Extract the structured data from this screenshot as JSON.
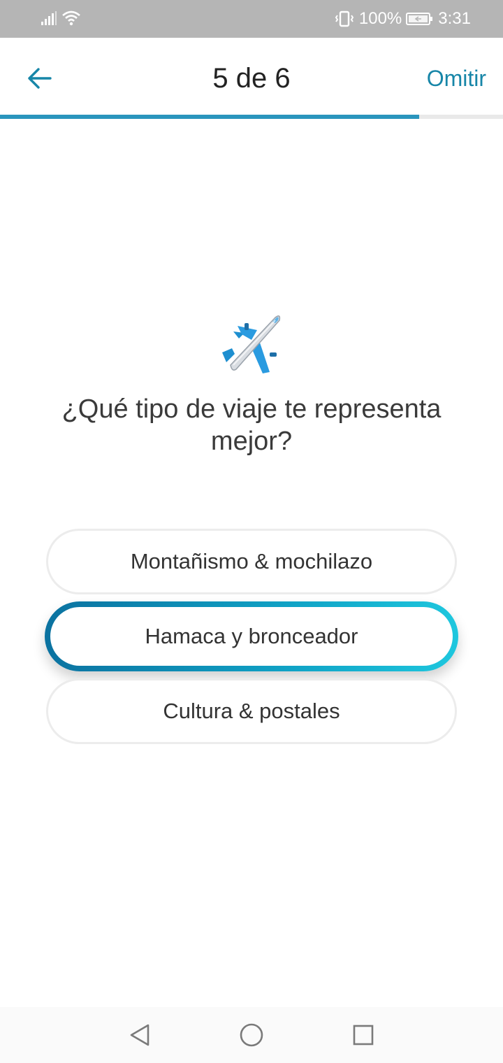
{
  "status_bar": {
    "battery": "100%",
    "time": "3:31",
    "icons": [
      "signal-icon",
      "wifi-icon",
      "vibrate-icon",
      "battery-icon"
    ]
  },
  "header": {
    "back_icon": "arrow-left-icon",
    "step_title": "5 de 6",
    "skip_label": "Omitir",
    "progress": 0.8333,
    "accent_color": "#1786a8"
  },
  "question": {
    "icon": "airplane-icon",
    "text": "¿Qué tipo de viaje te representa mejor?"
  },
  "options": [
    {
      "label": "Montañismo & mochilazo",
      "selected": false
    },
    {
      "label": "Hamaca y bronceador",
      "selected": true
    },
    {
      "label": "Cultura & postales",
      "selected": false
    }
  ],
  "nav_bar": {
    "icons": [
      "back-triangle-icon",
      "home-circle-icon",
      "recents-square-icon"
    ]
  }
}
